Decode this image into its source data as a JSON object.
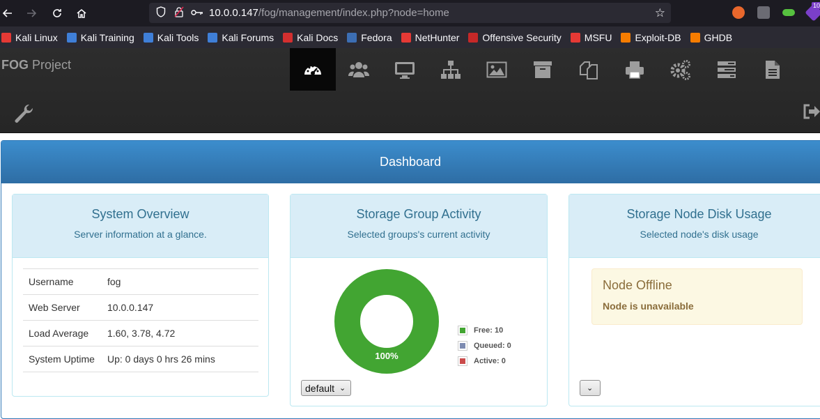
{
  "browser": {
    "url_host": "10.0.0.147",
    "url_path": "/fog/management/index.php?node=home",
    "extension_badge": "10",
    "bookmarks": [
      {
        "label": "Kali Linux",
        "color": "#e53935"
      },
      {
        "label": "Kali Training",
        "color": "#3f7fd8"
      },
      {
        "label": "Kali Tools",
        "color": "#3f7fd8"
      },
      {
        "label": "Kali Forums",
        "color": "#3f7fd8"
      },
      {
        "label": "Kali Docs",
        "color": "#d32f2f"
      },
      {
        "label": "Fedora",
        "color": "#3c6eb4"
      },
      {
        "label": "NetHunter",
        "color": "#e53935"
      },
      {
        "label": "Offensive Security",
        "color": "#c62828"
      },
      {
        "label": "MSFU",
        "color": "#e53935"
      },
      {
        "label": "Exploit-DB",
        "color": "#f57c00"
      },
      {
        "label": "GHDB",
        "color": "#f57c00"
      }
    ]
  },
  "header": {
    "brand_bold": "FOG",
    "brand_rest": " Project",
    "menu": [
      "dashboard-icon",
      "users-icon",
      "hosts-icon",
      "groups-icon",
      "images-icon",
      "storage-icon",
      "snapins-icon",
      "printers-icon",
      "services-icon",
      "tasks-icon",
      "reports-icon"
    ]
  },
  "dashboard": {
    "title": "Dashboard",
    "system_overview": {
      "title": "System Overview",
      "subtitle": "Server information at a glance.",
      "rows": [
        {
          "key": "Username",
          "value": "fog"
        },
        {
          "key": "Web Server",
          "value": "10.0.0.147"
        },
        {
          "key": "Load Average",
          "value": "1.60, 3.78, 4.72"
        },
        {
          "key": "System Uptime",
          "value": "Up: 0 days 0 hrs 26 mins"
        }
      ]
    },
    "storage_group": {
      "title": "Storage Group Activity",
      "subtitle": "Selected groups's current activity",
      "select_value": "default",
      "donut_label": "100%"
    },
    "storage_node": {
      "title": "Storage Node Disk Usage",
      "subtitle": "Selected node's disk usage",
      "alert_title": "Node Offline",
      "alert_message": "Node is unavailable",
      "select_value": ""
    }
  },
  "chart_data": {
    "type": "pie",
    "categories": [
      "Free: 10",
      "Queued: 0",
      "Active: 0"
    ],
    "values": [
      10,
      0,
      0
    ],
    "colors": [
      "#42a532",
      "#7d8bb1",
      "#cb4b4b"
    ],
    "donut": true,
    "center_label": "100%"
  }
}
